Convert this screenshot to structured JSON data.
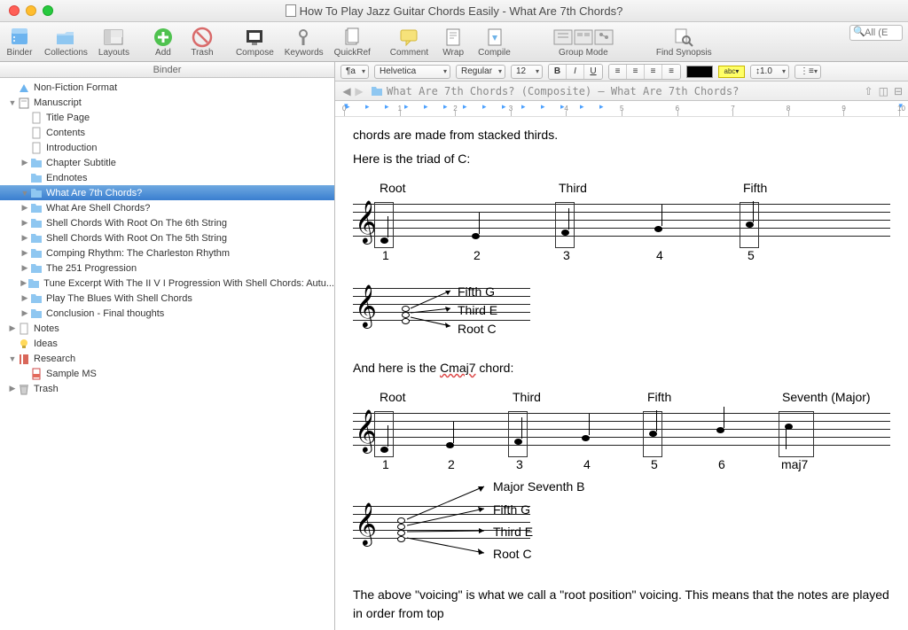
{
  "window_title": "How To Play Jazz Guitar Chords Easily - What Are 7th Chords?",
  "search_placeholder": "All (E",
  "toolbar": {
    "binder": "Binder",
    "collections": "Collections",
    "layouts": "Layouts",
    "add": "Add",
    "trash": "Trash",
    "compose": "Compose",
    "keywords": "Keywords",
    "quickref": "QuickRef",
    "comment": "Comment",
    "wrap": "Wrap",
    "compile": "Compile",
    "group_mode": "Group Mode",
    "find_synopsis": "Find Synopsis"
  },
  "format": {
    "para": "¶a",
    "font": "Helvetica",
    "weight": "Regular",
    "size": "12",
    "bold": "B",
    "italic": "I",
    "underline": "U",
    "linespace": "1.0"
  },
  "path": "What Are 7th Chords? (Composite) — What Are 7th Chords?",
  "binder_header": "Binder",
  "tree": [
    {
      "lvl": 0,
      "disc": "",
      "icon": "tri",
      "label": "Non-Fiction Format"
    },
    {
      "lvl": 0,
      "disc": "▼",
      "icon": "book",
      "label": "Manuscript"
    },
    {
      "lvl": 1,
      "disc": "",
      "icon": "doc",
      "label": "Title Page"
    },
    {
      "lvl": 1,
      "disc": "",
      "icon": "doc",
      "label": "Contents"
    },
    {
      "lvl": 1,
      "disc": "",
      "icon": "doc",
      "label": "Introduction"
    },
    {
      "lvl": 1,
      "disc": "▶",
      "icon": "folder",
      "label": "Chapter Subtitle"
    },
    {
      "lvl": 1,
      "disc": "",
      "icon": "folder",
      "label": "Endnotes"
    },
    {
      "lvl": 1,
      "disc": "▼",
      "icon": "folder",
      "label": "What Are 7th Chords?",
      "sel": true
    },
    {
      "lvl": 1,
      "disc": "▶",
      "icon": "folder",
      "label": "What Are Shell Chords?"
    },
    {
      "lvl": 1,
      "disc": "▶",
      "icon": "folder",
      "label": "Shell Chords With Root On The 6th String"
    },
    {
      "lvl": 1,
      "disc": "▶",
      "icon": "folder",
      "label": "Shell Chords With Root On The 5th String"
    },
    {
      "lvl": 1,
      "disc": "▶",
      "icon": "folder",
      "label": "Comping Rhythm: The Charleston Rhythm"
    },
    {
      "lvl": 1,
      "disc": "▶",
      "icon": "folder",
      "label": "The 251 Progression"
    },
    {
      "lvl": 1,
      "disc": "▶",
      "icon": "folder",
      "label": "Tune Excerpt With The  II V I Progression With Shell Chords: Autu..."
    },
    {
      "lvl": 1,
      "disc": "▶",
      "icon": "folder",
      "label": "Play The Blues With Shell Chords"
    },
    {
      "lvl": 1,
      "disc": "▶",
      "icon": "folder",
      "label": "Conclusion - Final thoughts"
    },
    {
      "lvl": 0,
      "disc": "▶",
      "icon": "doc",
      "label": "Notes"
    },
    {
      "lvl": 0,
      "disc": "",
      "icon": "bulb",
      "label": "Ideas"
    },
    {
      "lvl": 0,
      "disc": "▼",
      "icon": "book-red",
      "label": "Research"
    },
    {
      "lvl": 1,
      "disc": "",
      "icon": "pdf",
      "label": "Sample MS"
    },
    {
      "lvl": 0,
      "disc": "▶",
      "icon": "trash",
      "label": "Trash"
    }
  ],
  "doc": {
    "frag_top": "chords are made from stacked thirds.",
    "p1": "Here is the triad of C:",
    "p2": "And here is the ",
    "p2_span": "Cmaj7",
    "p2_end": " chord:",
    "p3": "The above \"voicing\" is what we call a \"root position\" voicing. This means that the notes are played in order from top",
    "triad": {
      "labels": [
        "Root",
        "Third",
        "Fifth"
      ],
      "nums": [
        "1",
        "2",
        "3",
        "4",
        "5"
      ]
    },
    "stack1": [
      "Fifth G",
      "Third E",
      "Root C"
    ],
    "seventh": {
      "labels": [
        "Root",
        "Third",
        "Fifth",
        "Seventh (Major)"
      ],
      "nums": [
        "1",
        "2",
        "3",
        "4",
        "5",
        "6",
        "maj7"
      ]
    },
    "stack2": [
      "Major Seventh B",
      "Fifth G",
      "Third E",
      "Root C"
    ]
  }
}
